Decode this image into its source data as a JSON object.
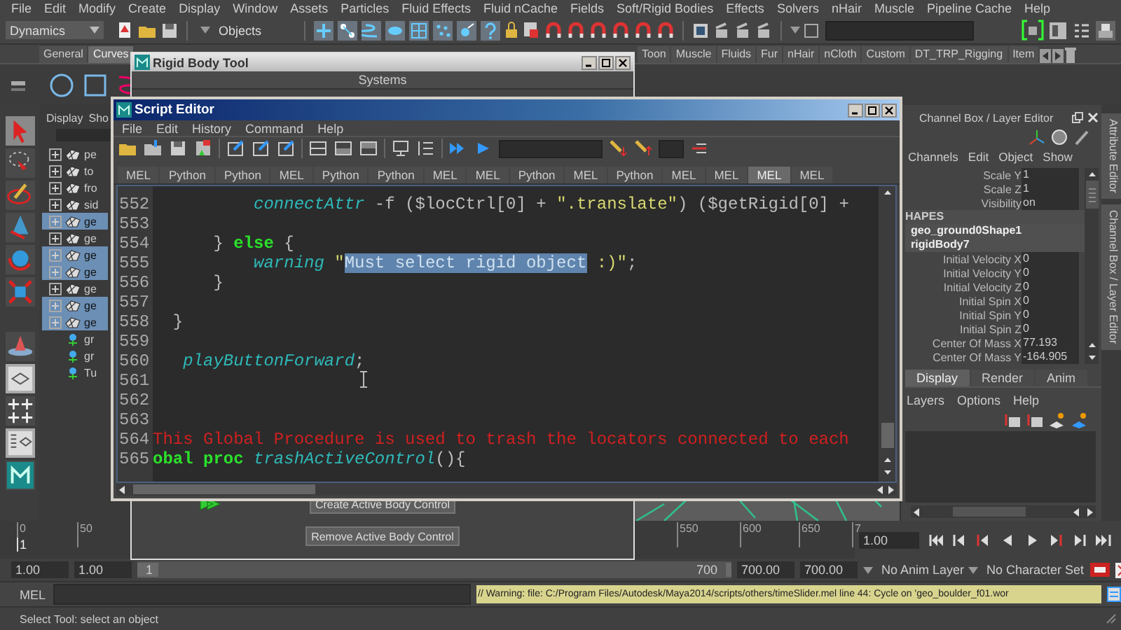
{
  "menu_bar": [
    "File",
    "Edit",
    "Modify",
    "Create",
    "Display",
    "Window",
    "Assets",
    "Particles",
    "Fluid Effects",
    "Fluid nCache",
    "Fields",
    "Soft/Rigid Bodies",
    "Effects",
    "Solvers",
    "nHair",
    "Muscle",
    "Pipeline Cache",
    "Help"
  ],
  "status_line": {
    "menu_set": "Dynamics",
    "selection_mode": "Objects"
  },
  "shelf": {
    "tabs_left": [
      {
        "label": "General",
        "selected": false
      },
      {
        "label": "Curves",
        "selected": true
      }
    ],
    "tabs_right": [
      {
        "label": "Toon",
        "selected": false
      },
      {
        "label": "Muscle",
        "selected": false
      },
      {
        "label": "Fluids",
        "selected": false
      },
      {
        "label": "Fur",
        "selected": false
      },
      {
        "label": "nHair",
        "selected": false
      },
      {
        "label": "nCloth",
        "selected": false
      },
      {
        "label": "Custom",
        "selected": false
      },
      {
        "label": "DT_TRP_Rigging",
        "selected": false
      },
      {
        "label": "Item",
        "selected": false
      }
    ]
  },
  "outliner": {
    "menus": [
      "Display",
      "Sho"
    ],
    "rows": [
      {
        "label": "pe",
        "selected": false
      },
      {
        "label": "to",
        "selected": false
      },
      {
        "label": "fro",
        "selected": false
      },
      {
        "label": "sid",
        "selected": false
      },
      {
        "label": "ge",
        "selected": true
      },
      {
        "label": "ge",
        "selected": false
      },
      {
        "label": "ge",
        "selected": true
      },
      {
        "label": "ge",
        "selected": true
      },
      {
        "label": "ge",
        "selected": false
      },
      {
        "label": "ge",
        "selected": true
      },
      {
        "label": "ge",
        "selected": true
      },
      {
        "label": "gr",
        "selected": false
      },
      {
        "label": "gr",
        "selected": false
      },
      {
        "label": "Tu",
        "selected": false
      }
    ]
  },
  "rigid_body_tool": {
    "title": "Rigid Body Tool",
    "section": "Systems",
    "buttons": [
      "Create Active Body Control",
      "Remove Active Body Control"
    ]
  },
  "script_editor": {
    "title": "Script Editor",
    "menus": [
      "File",
      "Edit",
      "History",
      "Command",
      "Help"
    ],
    "tabs": [
      {
        "label": "MEL",
        "selected": false
      },
      {
        "label": "Python",
        "selected": false
      },
      {
        "label": "Python",
        "selected": false
      },
      {
        "label": "MEL",
        "selected": false
      },
      {
        "label": "Python",
        "selected": false
      },
      {
        "label": "Python",
        "selected": false
      },
      {
        "label": "MEL",
        "selected": false
      },
      {
        "label": "MEL",
        "selected": false
      },
      {
        "label": "Python",
        "selected": false
      },
      {
        "label": "MEL",
        "selected": false
      },
      {
        "label": "Python",
        "selected": false
      },
      {
        "label": "MEL",
        "selected": false
      },
      {
        "label": "MEL",
        "selected": false
      },
      {
        "label": "MEL",
        "selected": true
      },
      {
        "label": "MEL",
        "selected": false
      }
    ],
    "lines": [
      {
        "number": "552",
        "tokens": [
          {
            "text": "          connectAttr",
            "kind": "function"
          },
          {
            "text": " -f ($locCtrl[0] + ",
            "kind": "plain"
          },
          {
            "text": "\".translate\"",
            "kind": "string"
          },
          {
            "text": ") ($getRigid[0] +",
            "kind": "plain"
          }
        ]
      },
      {
        "number": "553"
      },
      {
        "number": "554",
        "tokens": [
          {
            "text": "      } ",
            "kind": "plain"
          },
          {
            "text": "else",
            "kind": "keyword"
          },
          {
            "text": " {",
            "kind": "plain"
          }
        ]
      },
      {
        "number": "555",
        "tokens": [
          {
            "text": "          warning",
            "kind": "function"
          },
          {
            "text": " \"",
            "kind": "string"
          },
          {
            "text": "Must select rigid object",
            "kind": "selection"
          },
          {
            "text": " :)\"",
            "kind": "string"
          },
          {
            "text": ";",
            "kind": "plain"
          }
        ]
      },
      {
        "number": "556",
        "tokens": [
          {
            "text": "      }",
            "kind": "plain"
          }
        ]
      },
      {
        "number": "557"
      },
      {
        "number": "558",
        "tokens": [
          {
            "text": "  }",
            "kind": "plain"
          }
        ]
      },
      {
        "number": "559"
      },
      {
        "number": "560",
        "tokens": [
          {
            "text": "   playButtonForward",
            "kind": "function"
          },
          {
            "text": ";",
            "kind": "plain"
          }
        ]
      },
      {
        "number": "561"
      },
      {
        "number": "562"
      },
      {
        "number": "563"
      },
      {
        "number": "564",
        "tokens": [
          {
            "text": "This Global Procedure is used to trash the locators connected to each",
            "kind": "comment"
          }
        ]
      },
      {
        "number": "565",
        "tokens": [
          {
            "text": "obal proc",
            "kind": "keyword"
          },
          {
            "text": " trashActiveControl",
            "kind": "function"
          },
          {
            "text": "(){",
            "kind": "plain"
          }
        ]
      }
    ]
  },
  "channel_box": {
    "title": "Channel Box / Layer Editor",
    "menus": [
      "Channels",
      "Edit",
      "Object",
      "Show"
    ],
    "rows": [
      {
        "kind": "attribute",
        "label": "Scale Y",
        "value": "1"
      },
      {
        "kind": "attribute",
        "label": "Scale Z",
        "value": "1"
      },
      {
        "kind": "attribute",
        "label": "Visibility",
        "value": "on"
      },
      {
        "kind": "section",
        "label": "HAPES"
      },
      {
        "kind": "node",
        "label": "geo_ground0Shape1"
      },
      {
        "kind": "node",
        "label": "rigidBody7"
      },
      {
        "kind": "attribute",
        "label": "Initial Velocity X",
        "value": "0"
      },
      {
        "kind": "attribute",
        "label": "Initial Velocity Y",
        "value": "0"
      },
      {
        "kind": "attribute",
        "label": "Initial Velocity Z",
        "value": "0"
      },
      {
        "kind": "attribute",
        "label": "Initial Spin X",
        "value": "0"
      },
      {
        "kind": "attribute",
        "label": "Initial Spin Y",
        "value": "0"
      },
      {
        "kind": "attribute",
        "label": "Initial Spin Z",
        "value": "0"
      },
      {
        "kind": "attribute",
        "label": "Center Of Mass X",
        "value": "77.193"
      },
      {
        "kind": "attribute",
        "label": "Center Of Mass Y",
        "value": "-164.905"
      }
    ]
  },
  "layer_editor": {
    "tabs": [
      {
        "label": "Display",
        "selected": true
      },
      {
        "label": "Render",
        "selected": false
      },
      {
        "label": "Anim",
        "selected": false
      }
    ],
    "menus": [
      "Layers",
      "Options",
      "Help"
    ]
  },
  "side_tabs": [
    "Attribute Editor",
    "Channel Box / Layer Editor"
  ],
  "time_slider": {
    "ticks": [
      "0",
      "50",
      "550",
      "600",
      "650",
      "7"
    ],
    "current_frame": "1",
    "level": 0,
    "current_time": "1.00"
  },
  "range_slider": {
    "level": 1,
    "start_time": "1.00",
    "playback_start": "1.00",
    "range_start": "1",
    "range_end": "700",
    "playback_end": "700.00",
    "end_time": "700.00",
    "anim_layer": "No Anim Layer",
    "character_set": "No Character Set"
  },
  "command_line": {
    "language": "MEL",
    "result": "// Warning: file: C:/Program Files/Autodesk/Maya2014/scripts/others/timeSlider.mel line 44: Cycle on 'geo_boulder_f01.wor"
  },
  "help_line": "Select Tool: select an object"
}
